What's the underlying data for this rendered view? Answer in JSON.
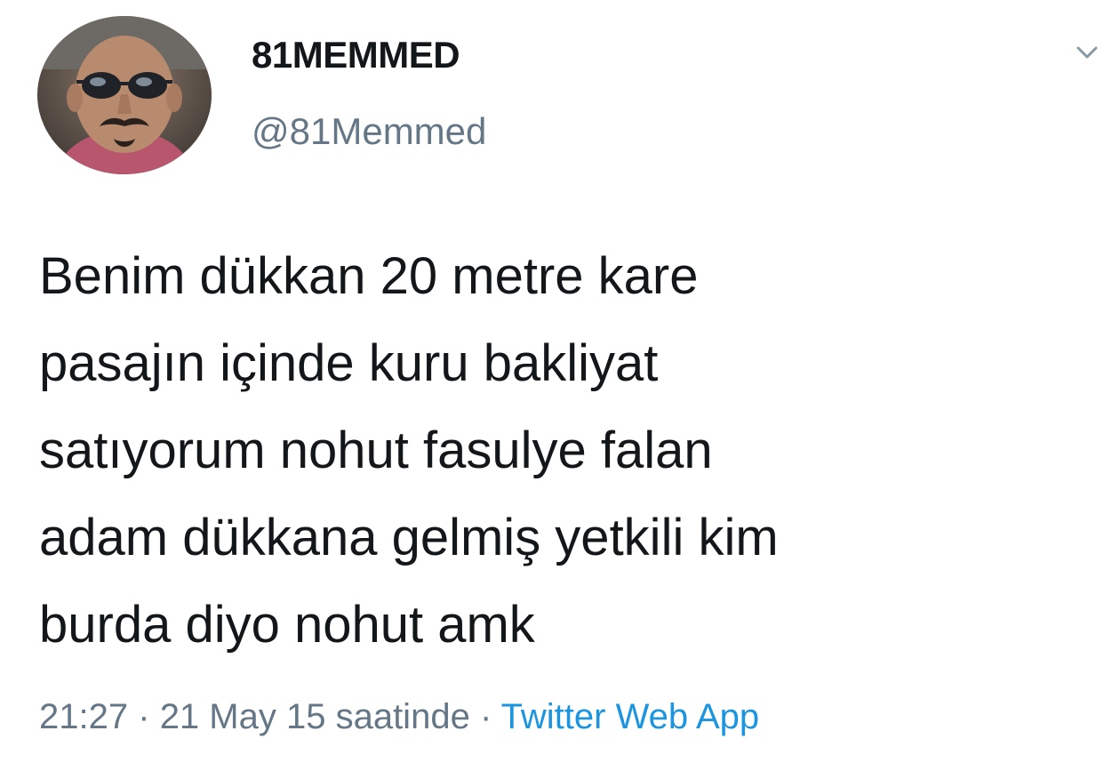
{
  "tweet": {
    "author": {
      "display_name": "81MEMMED",
      "handle": "@81Memmed",
      "avatar_icon": "avatar-photo"
    },
    "menu_icon": "chevron-down-icon",
    "text_lines": [
      "Benim dükkan 20 metre kare",
      "pasajın içinde kuru bakliyat",
      "satıyorum nohut fasulye falan",
      "adam dükkana gelmiş yetkili kim",
      "burda diyo nohut amk"
    ],
    "meta": {
      "time": "21:27",
      "separator": "·",
      "date": "21 May 15 saatinde",
      "source": "Twitter Web App"
    }
  },
  "colors": {
    "text": "#14171a",
    "secondary": "#657786",
    "link": "#1b95e0",
    "background": "#ffffff"
  }
}
